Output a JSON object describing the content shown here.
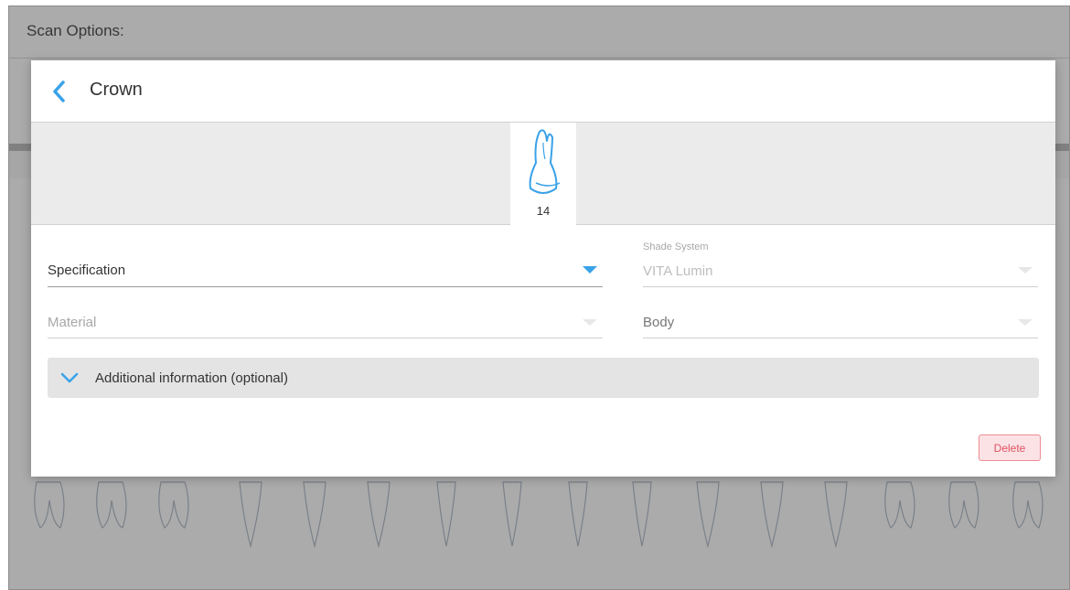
{
  "app": {
    "title": "Scan Options:"
  },
  "dialog": {
    "title": "Crown",
    "selected_tooth": "14",
    "fields": {
      "specification": {
        "value": "Specification"
      },
      "shade_system": {
        "label": "Shade System",
        "value": "VITA Lumin"
      },
      "material": {
        "value": "Material"
      },
      "body": {
        "value": "Body"
      }
    },
    "additional_info_label": "Additional information (optional)",
    "delete_label": "Delete"
  },
  "icons": {
    "back": "chevron-left-icon",
    "tooth": "tooth-icon",
    "expand": "chevron-down-icon"
  },
  "colors": {
    "accent": "#3aa2e8",
    "delete_text": "#e05262",
    "delete_border": "#ef8b95",
    "delete_bg": "#fbe3e5"
  }
}
